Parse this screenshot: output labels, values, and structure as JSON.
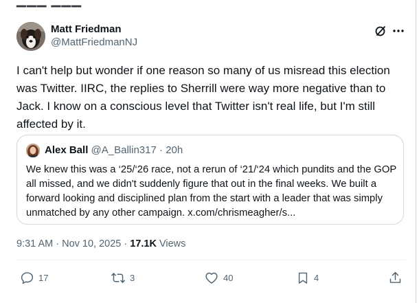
{
  "post": {
    "author": {
      "display_name": "Matt Friedman",
      "handle": "@MattFriedmanNJ"
    },
    "text": "I can't help but wonder if one reason so many of us misread this election was Twitter. IIRC, the replies to Sherrill were way more negative than to Jack. I know on a conscious level that Twitter isn't real life, but I'm still affected by it.",
    "quote": {
      "display_name": "Alex Ball",
      "handle": "@A_Ballin317",
      "separator": " · ",
      "age": "20h",
      "text": "We knew this was a ‘25/‘26 race, not a rerun of ‘21/‘24 which pundits and the GOP all missed, and we didn't suddenly figure that out in the final weeks. We built a forward looking and disciplined plan from the start with a leader that was simply unmatched by any other campaign. x.com/chrismeagher/s..."
    },
    "time": "9:31 AM",
    "dot": " · ",
    "date": "Nov 10, 2025",
    "views_count": "17.1K",
    "views_label": " Views",
    "actions": {
      "replies": "17",
      "reposts": "3",
      "likes": "40",
      "bookmarks": "4"
    }
  },
  "icons": {
    "grok": "grok-icon",
    "more": "more-icon",
    "reply": "reply-icon",
    "repost": "repost-icon",
    "like": "heart-icon",
    "bookmark": "bookmark-icon",
    "share": "share-icon"
  },
  "colors": {
    "text_primary": "#0f1419",
    "text_secondary": "#536471",
    "border": "#cfd9de"
  }
}
